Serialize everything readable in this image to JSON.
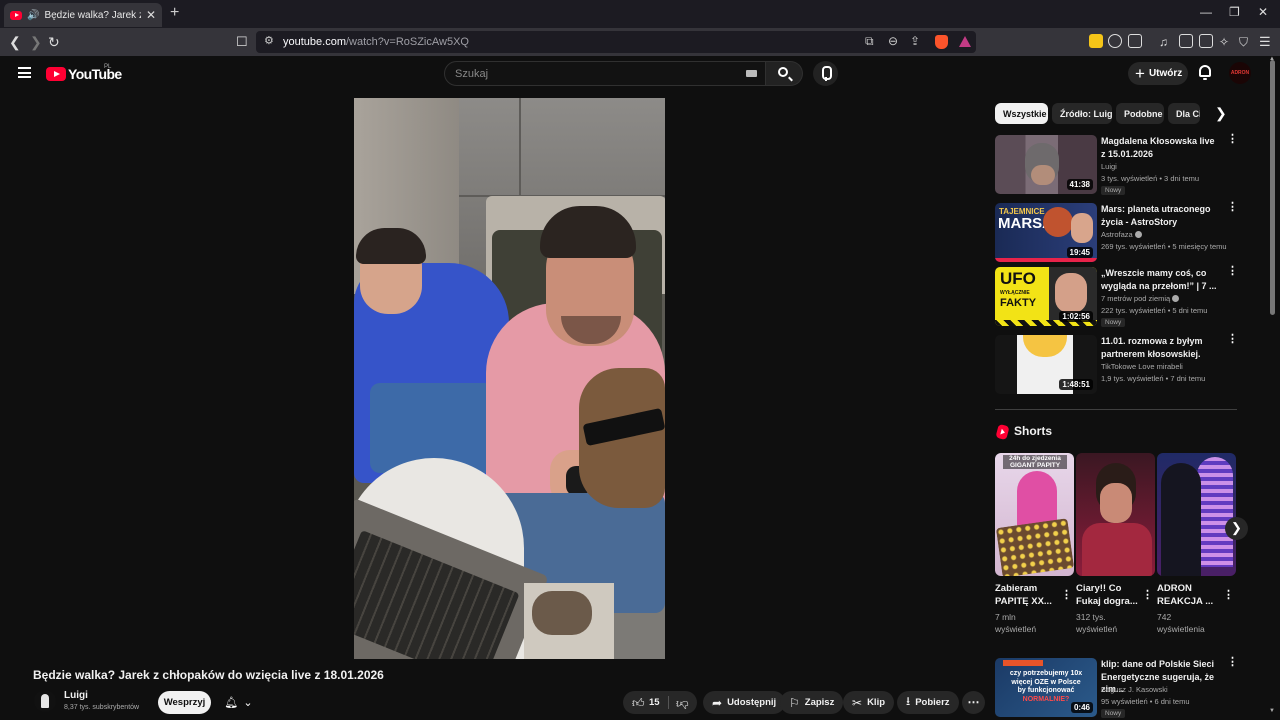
{
  "browser": {
    "tab_title": "Będzie walka? Jarek z chłopa",
    "url_domain": "youtube.com",
    "url_path": "/watch?v=RoSZicAw5XQ"
  },
  "header": {
    "logo_text": "YouTube",
    "country_code": "PL",
    "search_placeholder": "Szukaj",
    "create_label": "Utwórz",
    "avatar_text": "ADRON"
  },
  "video": {
    "title": "Będzie walka? Jarek z chłopaków do wzięcia live z 18.01.2026",
    "channel_name": "Luigi",
    "channel_subs": "8,37 tys. subskrybentów",
    "support_label": "Wesprzyj",
    "like_count": "15",
    "actions": {
      "share": "Udostępnij",
      "save": "Zapisz",
      "clip": "Klip",
      "download": "Pobierz"
    }
  },
  "sidebar": {
    "chips": [
      "Wszystkie",
      "Źródło: Luigi",
      "Podobne",
      "Dla Ciebie"
    ],
    "recommendations": [
      {
        "title": "Magdalena Kłosowska live z 15.01.2026",
        "channel": "Luigi",
        "views": "3 tys. wyświetleń • 3 dni temu",
        "duration": "41:38",
        "badge": "Nowy",
        "verified": false
      },
      {
        "title": "Mars: planeta utraconego życia - AstroStory",
        "channel": "Astrofaza",
        "views": "269 tys. wyświetleń • 5 miesięcy temu",
        "duration": "19:45",
        "badge": "",
        "verified": true
      },
      {
        "title": "„Wreszcie mamy coś, co wygląda na przełom!” | 7 ...",
        "channel": "7 metrów pod ziemią",
        "views": "222 tys. wyświetleń • 5 dni temu",
        "duration": "1:02:56",
        "badge": "Nowy",
        "verified": true
      },
      {
        "title": "11.01. rozmowa z byłym partnerem kłosowskiej.",
        "channel": "TikTokowe Love mirabeli",
        "views": "1,9 tys. wyświetleń • 7 dni temu",
        "duration": "1:48:51",
        "badge": "",
        "verified": false
      },
      {
        "title": "klip: dane od Polskie Sieci Energetyczne sugeruja, że zim...",
        "channel": "Bogusz J. Kasowski",
        "views": "95 wyświetleń • 6 dni temu",
        "duration": "0:46",
        "badge": "Nowy",
        "verified": false
      }
    ],
    "shorts_title": "Shorts",
    "shorts": [
      {
        "title": "Zabieram PAPITĘ XX...",
        "views": "7 mln wyświetleń",
        "overlay": "24h do zjedzenia GIGANT PAPITY"
      },
      {
        "title": "Ciary!! Co Fukaj dogra...",
        "views": "312 tys. wyświetleń",
        "overlay": ""
      },
      {
        "title": "ADRON REAKCJA ...",
        "views": "742 wyświetlenia",
        "overlay": ""
      }
    ],
    "thumb_text": {
      "mars_line1": "TAJEMNICE",
      "mars_line2": "MARSA",
      "ufo_line1": "UFO",
      "ufo_line2": "WYŁĄCZNIE",
      "ufo_line3": "FAKTY",
      "klip_line1": "czy potrzebujemy 10x",
      "klip_line2": "więcej OZE w Polsce",
      "klip_line3": "by funkcjonować",
      "klip_line4": "NORMALNIE?"
    }
  }
}
